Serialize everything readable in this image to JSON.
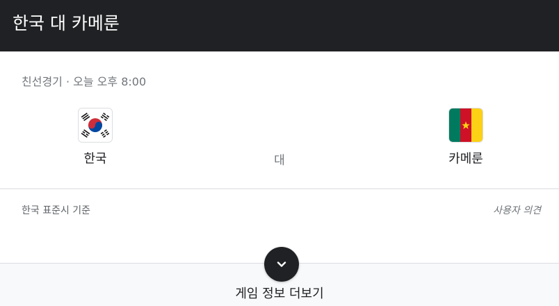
{
  "header": {
    "title": "한국 대 카메룬"
  },
  "match": {
    "meta": "친선경기 · 오늘 오후 8:00",
    "versus": "대",
    "home": {
      "name": "한국",
      "flag": "south-korea-flag-icon"
    },
    "away": {
      "name": "카메룬",
      "flag": "cameroon-flag-icon"
    }
  },
  "footer": {
    "timezone": "한국 표준시 기준",
    "feedback": "사용자 의견"
  },
  "more": {
    "label": "게임 정보 더보기",
    "icon": "chevron-down-icon"
  },
  "colors": {
    "header_bg": "#202124",
    "korea_red": "#cd2e3a",
    "korea_blue": "#0047a0",
    "cameroon_green": "#007a5e",
    "cameroon_red": "#ce1126",
    "cameroon_yellow": "#fcd116"
  }
}
